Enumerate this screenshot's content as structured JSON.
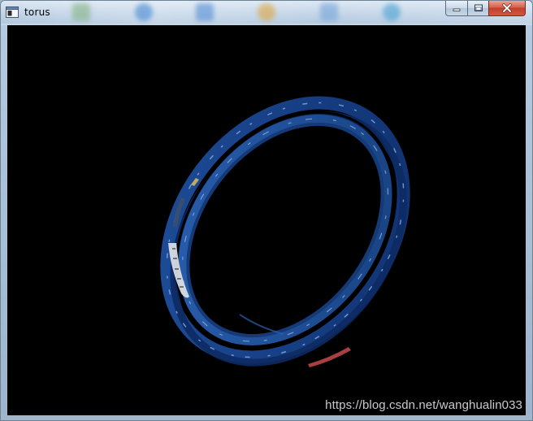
{
  "window": {
    "title": "torus",
    "icon": "app-window-icon"
  },
  "caption": {
    "minimize_icon": "minimize-icon",
    "maximize_icon": "maximize-icon",
    "close_icon": "close-icon"
  },
  "viewport": {
    "background": "#000000",
    "scene": "rotating-textured-torus",
    "torus_color": "#1c4fa0"
  },
  "watermark": {
    "text": "https://blog.csdn.net/wanghualin033"
  },
  "colors": {
    "titlebar": "#c1d4e7",
    "close_button": "#c1402a"
  }
}
